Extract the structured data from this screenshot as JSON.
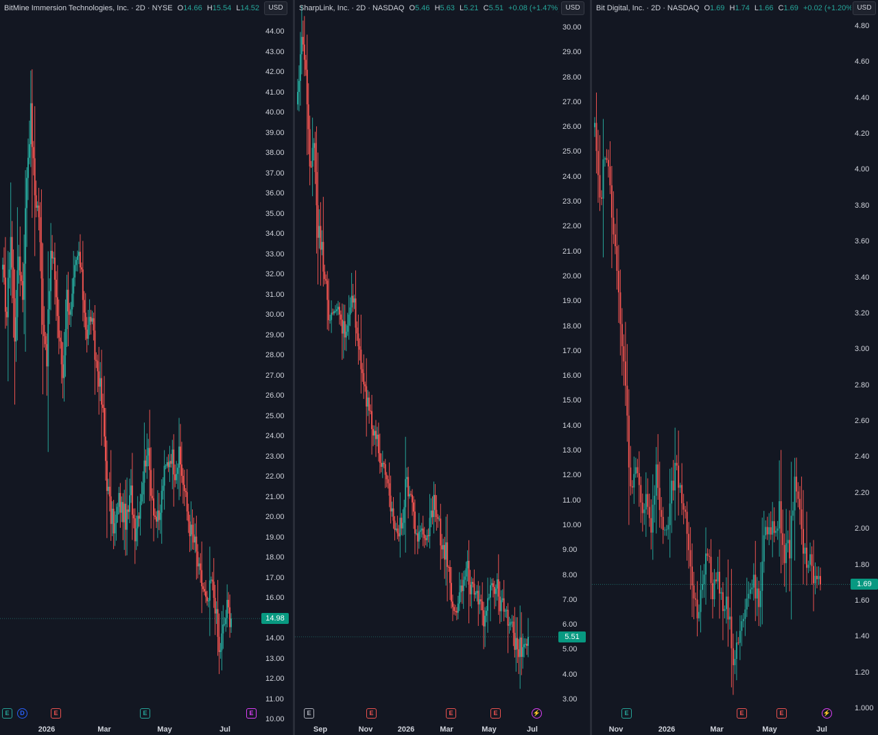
{
  "colors": {
    "background": "#131722",
    "up": "#26a69a",
    "down": "#ef5350",
    "text": "#d1d4dc",
    "badge": "#089981",
    "grid": "#1e2230"
  },
  "currency_label": "USD",
  "panes": [
    {
      "symbol_title": "BitMine Immersion Technologies, Inc. · 2D · NYSE",
      "ohlc": {
        "o_label": "O",
        "o": "14.66",
        "h_label": "H",
        "h": "15.54",
        "l_label": "L",
        "l": "14.52..."
      },
      "change": "",
      "price_ticks": [
        "44.00",
        "43.00",
        "42.00",
        "41.00",
        "40.00",
        "39.00",
        "38.00",
        "37.00",
        "36.00",
        "35.00",
        "34.00",
        "33.00",
        "32.00",
        "31.00",
        "30.00",
        "29.00",
        "28.00",
        "27.00",
        "26.00",
        "25.00",
        "24.00",
        "23.00",
        "22.00",
        "21.00",
        "20.00",
        "19.00",
        "18.00",
        "17.00",
        "16.00",
        "15.00",
        "14.00",
        "13.00",
        "12.00",
        "11.00",
        "10.00"
      ],
      "last_price": "14.98",
      "last_price_value": 14.98,
      "time_labels": [
        "2026",
        "Mar",
        "May",
        "Jul"
      ],
      "markers": [
        {
          "kind": "E",
          "color": "#26a69a",
          "shape": "square"
        },
        {
          "kind": "D",
          "color": "#2962ff",
          "shape": "round"
        },
        {
          "kind": "E",
          "color": "#ef5350",
          "shape": "square"
        },
        {
          "kind": "E",
          "color": "#26a69a",
          "shape": "square"
        },
        {
          "kind": "E",
          "color": "#e040fb",
          "shape": "square"
        }
      ]
    },
    {
      "symbol_title": "SharpLink, Inc. · 2D · NASDAQ",
      "ohlc": {
        "o_label": "O",
        "o": "5.46",
        "h_label": "H",
        "h": "5.63",
        "l_label": "L",
        "l": "5.21",
        "c_label": "C",
        "c": "5.51"
      },
      "change": "+0.08 (+1.47%)",
      "price_ticks": [
        "30.00",
        "29.00",
        "28.00",
        "27.00",
        "26.00",
        "25.00",
        "24.00",
        "23.00",
        "22.00",
        "21.00",
        "20.00",
        "19.00",
        "18.00",
        "17.00",
        "16.00",
        "15.00",
        "14.00",
        "13.00",
        "12.00",
        "11.00",
        "10.00",
        "9.00",
        "8.00",
        "7.00",
        "6.00",
        "5.00",
        "4.00",
        "3.00"
      ],
      "last_price": "5.51",
      "last_price_value": 5.51,
      "time_labels": [
        "Sep",
        "Nov",
        "2026",
        "Mar",
        "May",
        "Jul"
      ],
      "markers": [
        {
          "kind": "E",
          "color": "#b2b5be",
          "shape": "square"
        },
        {
          "kind": "E",
          "color": "#ef5350",
          "shape": "square"
        },
        {
          "kind": "E",
          "color": "#ef5350",
          "shape": "square"
        },
        {
          "kind": "E",
          "color": "#ef5350",
          "shape": "square"
        },
        {
          "kind": "⚡",
          "color": "#e040fb",
          "shape": "round"
        }
      ]
    },
    {
      "symbol_title": "Bit Digital, Inc. · 2D · NASDAQ",
      "ohlc": {
        "o_label": "O",
        "o": "1.69",
        "h_label": "H",
        "h": "1.74",
        "l_label": "L",
        "l": "1.66",
        "c_label": "C",
        "c": "1.69"
      },
      "change": "+0.02 (+1.20%)",
      "price_ticks": [
        "4.80",
        "4.60",
        "4.40",
        "4.20",
        "4.00",
        "3.80",
        "3.60",
        "3.40",
        "3.20",
        "3.00",
        "2.80",
        "2.60",
        "2.40",
        "2.20",
        "2.00",
        "1.80",
        "1.60",
        "1.40",
        "1.20",
        "1.000"
      ],
      "last_price": "1.69",
      "last_price_value": 1.69,
      "time_labels": [
        "Nov",
        "2026",
        "Mar",
        "May",
        "Jul"
      ],
      "markers": [
        {
          "kind": "E",
          "color": "#26a69a",
          "shape": "square"
        },
        {
          "kind": "E",
          "color": "#ef5350",
          "shape": "square"
        },
        {
          "kind": "E",
          "color": "#ef5350",
          "shape": "square"
        },
        {
          "kind": "⚡",
          "color": "#e040fb",
          "shape": "round"
        }
      ]
    }
  ],
  "chart_data": [
    {
      "type": "candlestick",
      "title": "BitMine Immersion Technologies, Inc. · 2D · NYSE",
      "ylim": [
        10,
        44.5
      ],
      "path": [
        32,
        30,
        34,
        29,
        33,
        31,
        37,
        40,
        36,
        35,
        30,
        28,
        33,
        32,
        29,
        27,
        31,
        30,
        32,
        33,
        31,
        29,
        30,
        28,
        27,
        25,
        21.8,
        20,
        19.5,
        20.8,
        20.2,
        19.8,
        21.2,
        19.4,
        20.5,
        22,
        23.5,
        21.6,
        20.1,
        19.6,
        21.8,
        22.6,
        23.2,
        22.4,
        22.9,
        21.8,
        20.3,
        19.2,
        18.6,
        17.2,
        16.5,
        15.4,
        16.8,
        15.8,
        13.2,
        14.4,
        15.5,
        14.98
      ]
    },
    {
      "type": "candlestick",
      "title": "SharpLink, Inc. · 2D · NASDAQ",
      "ylim": [
        2.5,
        30.5
      ],
      "path": [
        27,
        30,
        28,
        24.5,
        25.5,
        22,
        21,
        20,
        18,
        18.5,
        19,
        18,
        17.5,
        18.8,
        19,
        17,
        16.5,
        15,
        14.5,
        13.8,
        13,
        12.3,
        11.5,
        10.8,
        10,
        9.6,
        10.5,
        11.8,
        11.2,
        10,
        9.3,
        9.8,
        9.4,
        10.6,
        11,
        9.8,
        9.2,
        8.7,
        7.2,
        6.8,
        7.2,
        7.6,
        8.1,
        7.4,
        7.1,
        6.6,
        6.4,
        7.2,
        7.8,
        7.5,
        7.0,
        6.5,
        6.1,
        5.7,
        5.3,
        5.0,
        5.4,
        5.51
      ]
    },
    {
      "type": "candlestick",
      "title": "Bit Digital, Inc. · 2D · NASDAQ",
      "ylim": [
        0.95,
        4.85
      ],
      "path": [
        4.2,
        3.8,
        4.1,
        3.9,
        3.6,
        3.1,
        2.8,
        2.2,
        2.4,
        2.1,
        2.2,
        2.0,
        2.3,
        2.05,
        1.95,
        2.2,
        2.35,
        2.1,
        2.0,
        1.7,
        1.5,
        1.75,
        1.85,
        1.65,
        1.75,
        1.6,
        1.55,
        1.3,
        1.38,
        1.5,
        1.6,
        1.72,
        1.55,
        1.9,
        2.05,
        1.95,
        2.1,
        1.85,
        1.9,
        2.25,
        2.05,
        1.85,
        1.8,
        1.72,
        1.69
      ]
    }
  ]
}
